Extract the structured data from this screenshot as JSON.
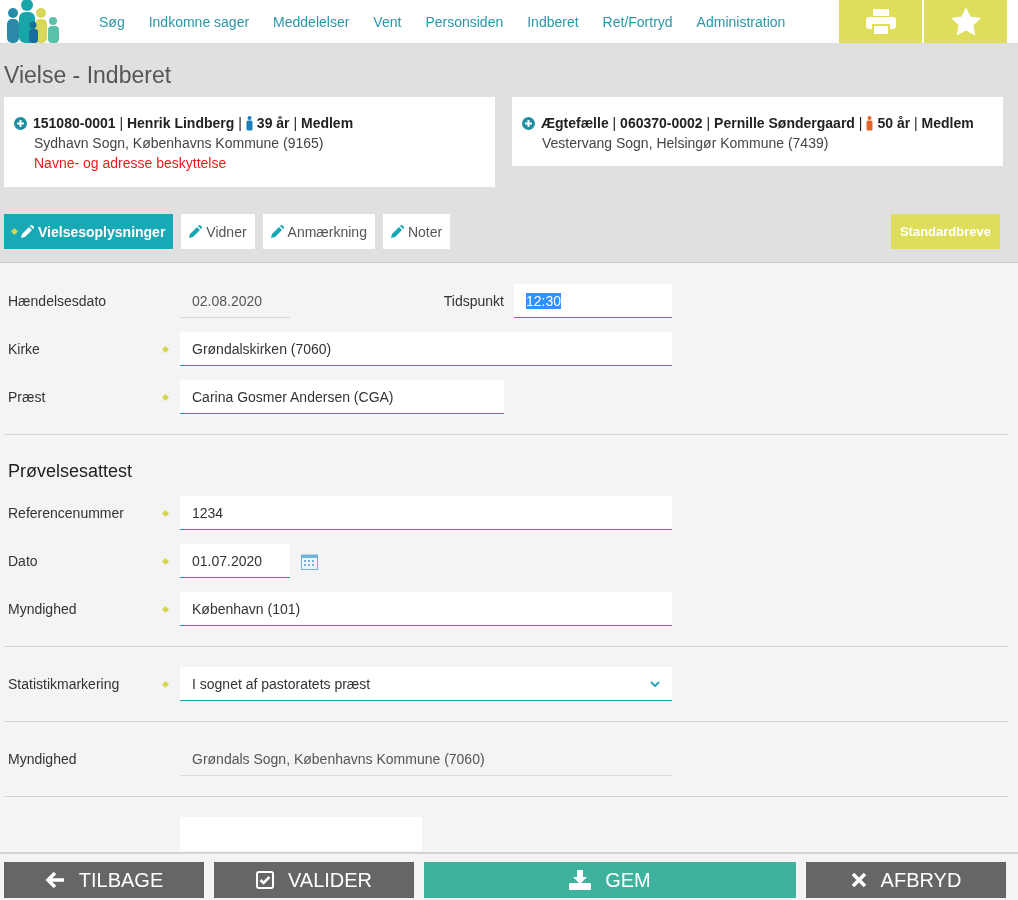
{
  "nav": {
    "items": [
      {
        "label": "Søg"
      },
      {
        "label": "Indkomne sager"
      },
      {
        "label": "Meddelelser"
      },
      {
        "label": "Vent"
      },
      {
        "label": "Personsiden"
      },
      {
        "label": "Indberet"
      },
      {
        "label": "Ret/Fortryd"
      },
      {
        "label": "Administration"
      }
    ]
  },
  "page_title": "Vielse - Indberet",
  "persons": [
    {
      "lead": "**151080-0001** | **Henrik Lindberg** |",
      "color": "#1a7fb8",
      "age": "**39 år** | **Medlem**",
      "address": "Sydhavn Sogn, Københavns Kommune (9165)",
      "warning": "Navne- og adresse beskyttelse"
    },
    {
      "lead": "**Ægtefælle** | **060370-0002** | **Pernille Søndergaard** |",
      "color": "#e0662a",
      "age": "**50 år** | **Medlem**",
      "address": "Vestervang Sogn, Helsingør Kommune (7439)"
    }
  ],
  "tabs": [
    {
      "label": "Vielsesoplysninger",
      "selected": true,
      "marked": true
    },
    {
      "label": "Vidner",
      "selected": false,
      "marked": false
    },
    {
      "label": "Anmærkning",
      "selected": false,
      "marked": false
    },
    {
      "label": "Noter",
      "selected": false,
      "marked": false
    }
  ],
  "standard_button": "Standardbreve",
  "sections": [
    {
      "rows": [
        {
          "kind": "pair",
          "label": "Hændelsesdato",
          "value": "02.08.2020",
          "label2": "Tidspunkt",
          "value2": "12:30",
          "value2_selected": true
        },
        {
          "kind": "text",
          "label": "Kirke",
          "required": true,
          "value": "Grøndalskirken (7060)"
        },
        {
          "kind": "text",
          "label": "Præst",
          "required": true,
          "value": "Carina Gosmer Andersen (CGA)"
        }
      ]
    },
    {
      "title": "Prøvelsesattest",
      "rows": [
        {
          "kind": "text",
          "label": "Referencenummer",
          "required": true,
          "value": "1234"
        },
        {
          "kind": "date",
          "label": "Dato",
          "required": true,
          "value": "01.07.2020"
        },
        {
          "kind": "text",
          "label": "Myndighed",
          "required": true,
          "value": "København (101)"
        }
      ]
    },
    {
      "rows": [
        {
          "kind": "select",
          "label": "Statistikmarkering",
          "required": true,
          "value": "I sognet af pastoratets præst"
        }
      ]
    },
    {
      "rows": [
        {
          "kind": "readonly",
          "label": "Myndighed",
          "value": "Grøndals Sogn, Københavns Kommune (7060)"
        }
      ]
    },
    {
      "rows": [
        {
          "kind": "blank"
        }
      ]
    }
  ],
  "footer": [
    {
      "kind": "back",
      "label": "TILBAGE"
    },
    {
      "kind": "validate",
      "label": "VALIDER"
    },
    {
      "kind": "save",
      "label": "GEM"
    },
    {
      "kind": "cancel",
      "label": "AFBRYD"
    }
  ]
}
